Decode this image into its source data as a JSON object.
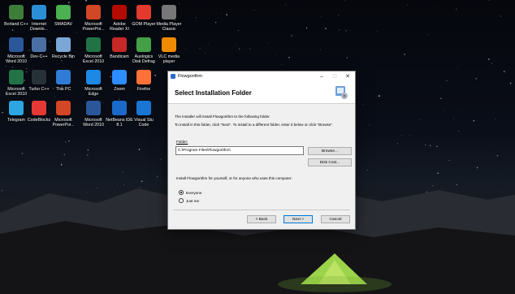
{
  "desktop": {
    "icons": [
      {
        "label": "Borland C++",
        "icon": "borland-icon",
        "color": "#3e7c3a"
      },
      {
        "label": "Internet\nDownlo...",
        "icon": "idm-icon",
        "color": "#2a8fd6"
      },
      {
        "label": "SMADAV",
        "icon": "smadav-icon",
        "color": "#4caf50"
      },
      {
        "label": "Microsoft\nPowerPoi...",
        "icon": "powerpoint-icon",
        "color": "#d24726"
      },
      {
        "label": "Adobe\nReader XI",
        "icon": "acrobat-icon",
        "color": "#b30b00"
      },
      {
        "label": "GOM Player",
        "icon": "gom-icon",
        "color": "#e23b2e"
      },
      {
        "label": "Media Player\nClassic",
        "icon": "mpc-icon",
        "color": "#777777"
      },
      {
        "label": "Microsoft\nWord 2010",
        "icon": "word-icon",
        "color": "#2b579a"
      },
      {
        "label": "Dev-C++",
        "icon": "devcpp-icon",
        "color": "#4a6fa5"
      },
      {
        "label": "Recycle Bin",
        "icon": "recycle-bin-icon",
        "color": "#7aa7d6"
      },
      {
        "label": "Microsoft\nExcel 2010",
        "icon": "excel-icon",
        "color": "#217346"
      },
      {
        "label": "Bandicam",
        "icon": "bandicam-icon",
        "color": "#c62828"
      },
      {
        "label": "Auslogics\nDisk Defrag",
        "icon": "defrag-icon",
        "color": "#43a047"
      },
      {
        "label": "VLC media\nplayer",
        "icon": "vlc-icon",
        "color": "#f08a00"
      },
      {
        "label": "Microsoft\nExcel 2010",
        "icon": "excel-icon",
        "color": "#217346"
      },
      {
        "label": "Turbo C++",
        "icon": "turbo-cpp-icon",
        "color": "#263238"
      },
      {
        "label": "This PC",
        "icon": "this-pc-icon",
        "color": "#2f7bd6"
      },
      {
        "label": "Microsoft\nEdge",
        "icon": "edge-icon",
        "color": "#1e88e5"
      },
      {
        "label": "Zoom",
        "icon": "zoom-icon",
        "color": "#2d8cff"
      },
      {
        "label": "Firefox",
        "icon": "firefox-icon",
        "color": "#ff7139"
      },
      {
        "label": "Telegram",
        "icon": "telegram-icon",
        "color": "#2ca5e0"
      },
      {
        "label": "CodeBlocks",
        "icon": "codeblocks-icon",
        "color": "#e53935"
      },
      {
        "label": "Microsoft\nPowerPoi...",
        "icon": "powerpoint-icon",
        "color": "#d24726"
      },
      {
        "label": "Microsoft\nWord 2010",
        "icon": "word-icon",
        "color": "#2b579a"
      },
      {
        "label": "NetBeans IDE\n8.1",
        "icon": "netbeans-icon",
        "color": "#1b6ac9"
      },
      {
        "label": "Visual Stu\nCode",
        "icon": "vscode-icon",
        "color": "#1976d2"
      }
    ]
  },
  "installer": {
    "window_title": "Flowgorithm",
    "heading": "Select Installation Folder",
    "intro": "The installer will install Flowgorithm to the following folder.",
    "instructions": "To install in this folder, click \"Next\". To install to a different folder, enter it below or click \"Browse\".",
    "folder_label": "Folder:",
    "folder_value": "C:\\Program Files\\Flowgorithm\\",
    "browse_label": "Browse...",
    "disk_cost_label": "Disk Cost...",
    "audience_prompt": "Install Flowgorithm for yourself, or for anyone who uses this computer:",
    "options": [
      {
        "label": "Everyone",
        "selected": true
      },
      {
        "label": "Just me",
        "selected": false
      }
    ],
    "back_label": "< Back",
    "next_label": "Next >",
    "cancel_label": "Cancel",
    "accent": "#0078d7"
  }
}
